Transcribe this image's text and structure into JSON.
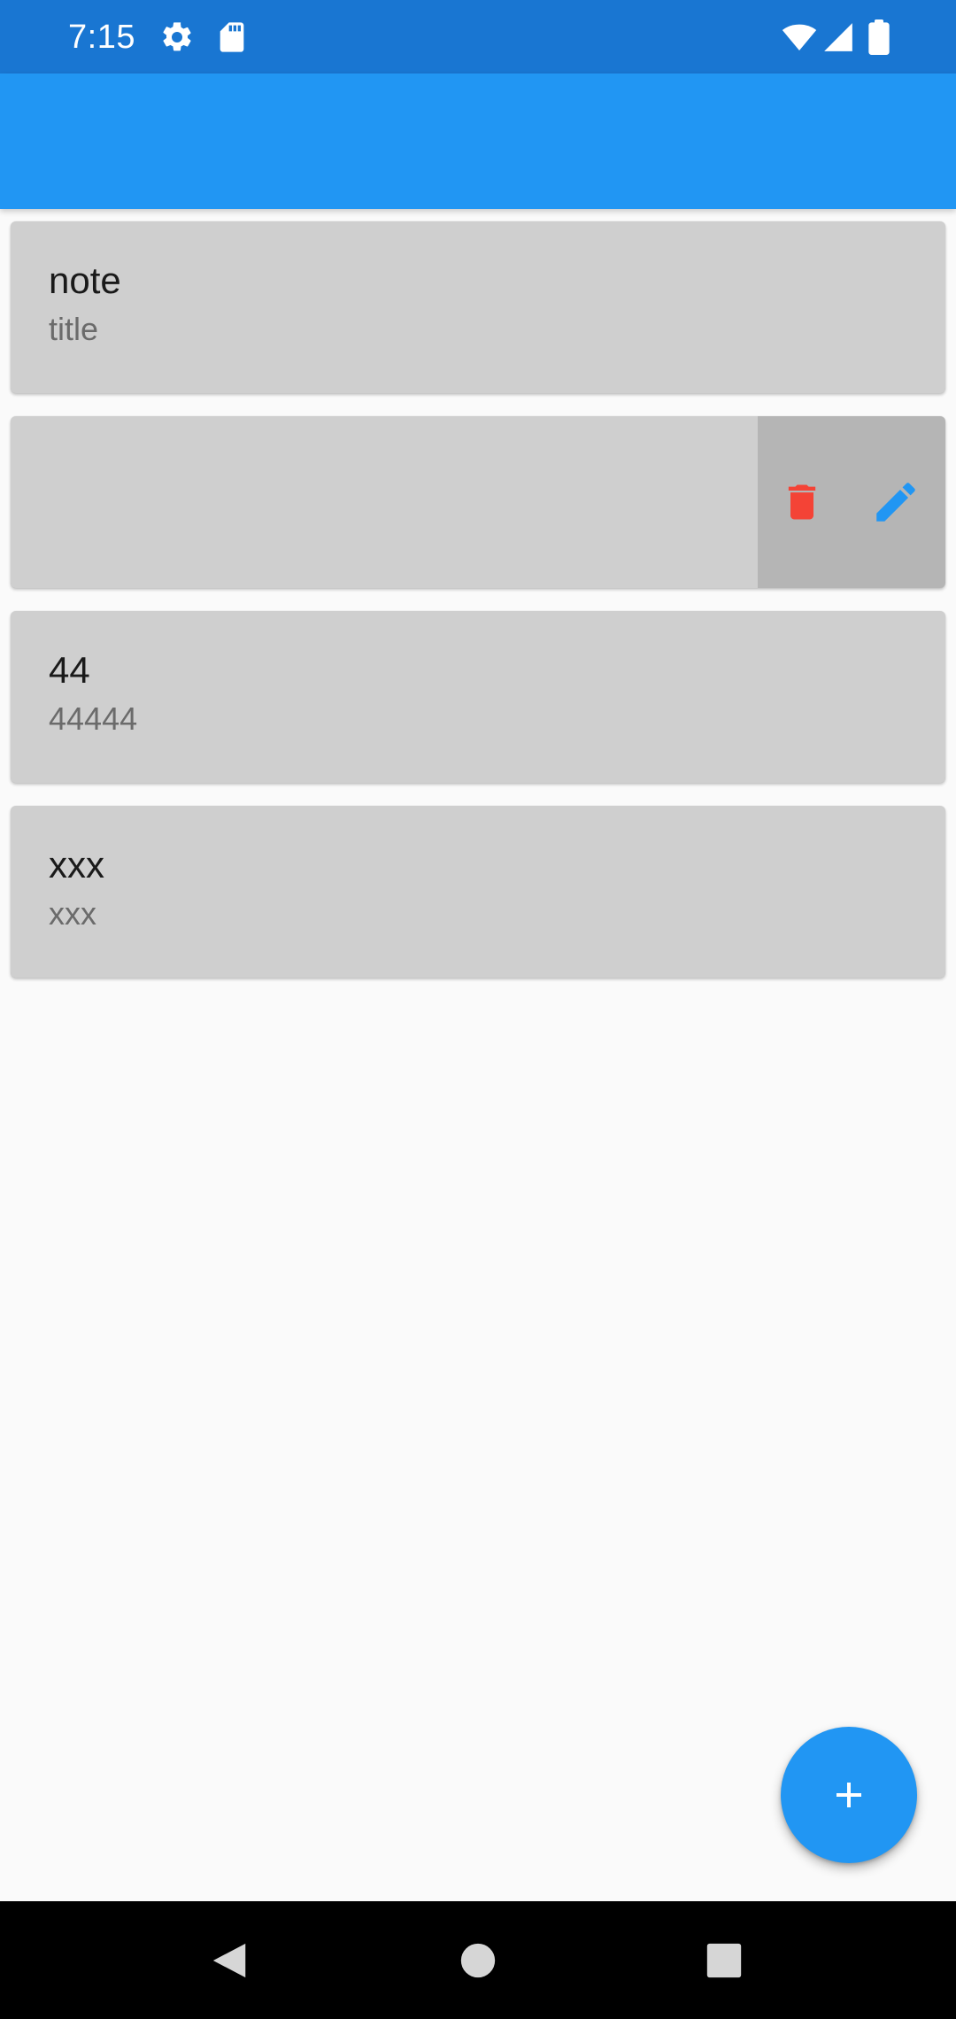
{
  "status_bar": {
    "time": "7:15",
    "left_icons": [
      "gear-icon",
      "sd-card-icon"
    ],
    "right_icons": [
      "wifi-icon",
      "signal-icon",
      "battery-icon"
    ],
    "background": "#1976d2"
  },
  "app_bar": {
    "background": "#2196f3"
  },
  "notes": [
    {
      "title": "note",
      "subtitle": "title"
    },
    {
      "title": "",
      "subtitle": "",
      "swiped_open": true,
      "actions": [
        "trash-icon",
        "pencil-icon"
      ]
    },
    {
      "title": "44",
      "subtitle": "44444"
    },
    {
      "title": "xxx",
      "subtitle": "xxx"
    }
  ],
  "colors": {
    "card": "#cfcfcf",
    "actions_panel": "#b5b5b5",
    "delete": "#f44336",
    "edit": "#2196f3",
    "fab": "#2196f3"
  },
  "fab": {
    "icon": "plus-icon"
  },
  "nav_bar": {
    "buttons": [
      "back-icon",
      "home-icon",
      "recents-icon"
    ]
  }
}
